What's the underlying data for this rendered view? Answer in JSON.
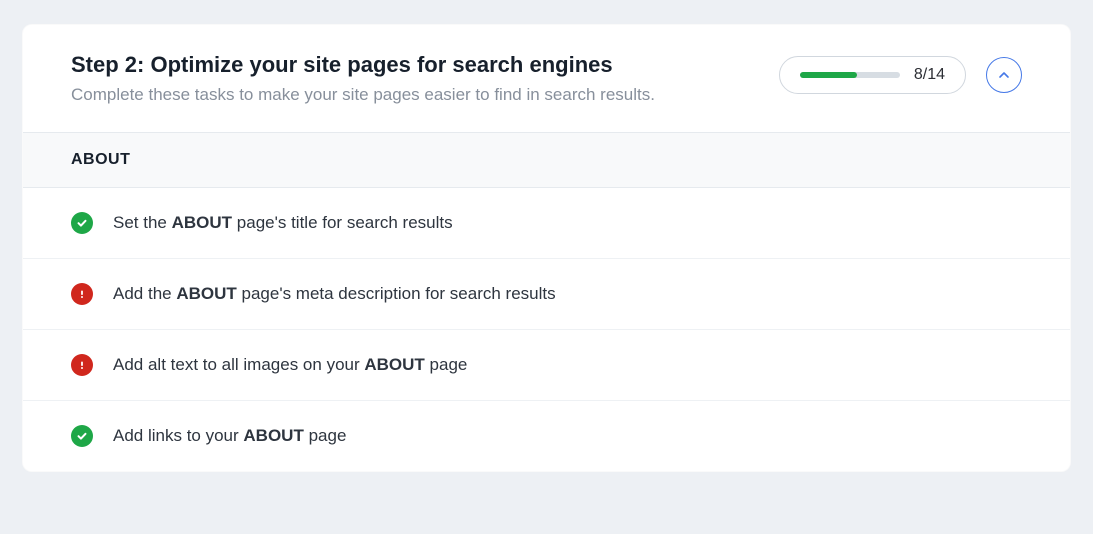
{
  "card": {
    "title": "Step 2: Optimize your site pages for search engines",
    "subtitle": "Complete these tasks to make your site pages easier to find in search results.",
    "progress": {
      "done": 8,
      "total": 14,
      "text": "8/14"
    }
  },
  "section": {
    "title": "ABOUT"
  },
  "tasks": [
    {
      "status": "ok",
      "pre": "Set the ",
      "bold": "ABOUT",
      "post": " page's title for search results"
    },
    {
      "status": "warn",
      "pre": "Add the ",
      "bold": "ABOUT",
      "post": " page's meta description for search results"
    },
    {
      "status": "warn",
      "pre": "Add alt text to all images on your ",
      "bold": "ABOUT",
      "post": " page"
    },
    {
      "status": "ok",
      "pre": "Add links to your ",
      "bold": "ABOUT",
      "post": " page"
    }
  ],
  "colors": {
    "ok": "#1ea747",
    "warn": "#d0271d",
    "accent": "#4679e7"
  }
}
